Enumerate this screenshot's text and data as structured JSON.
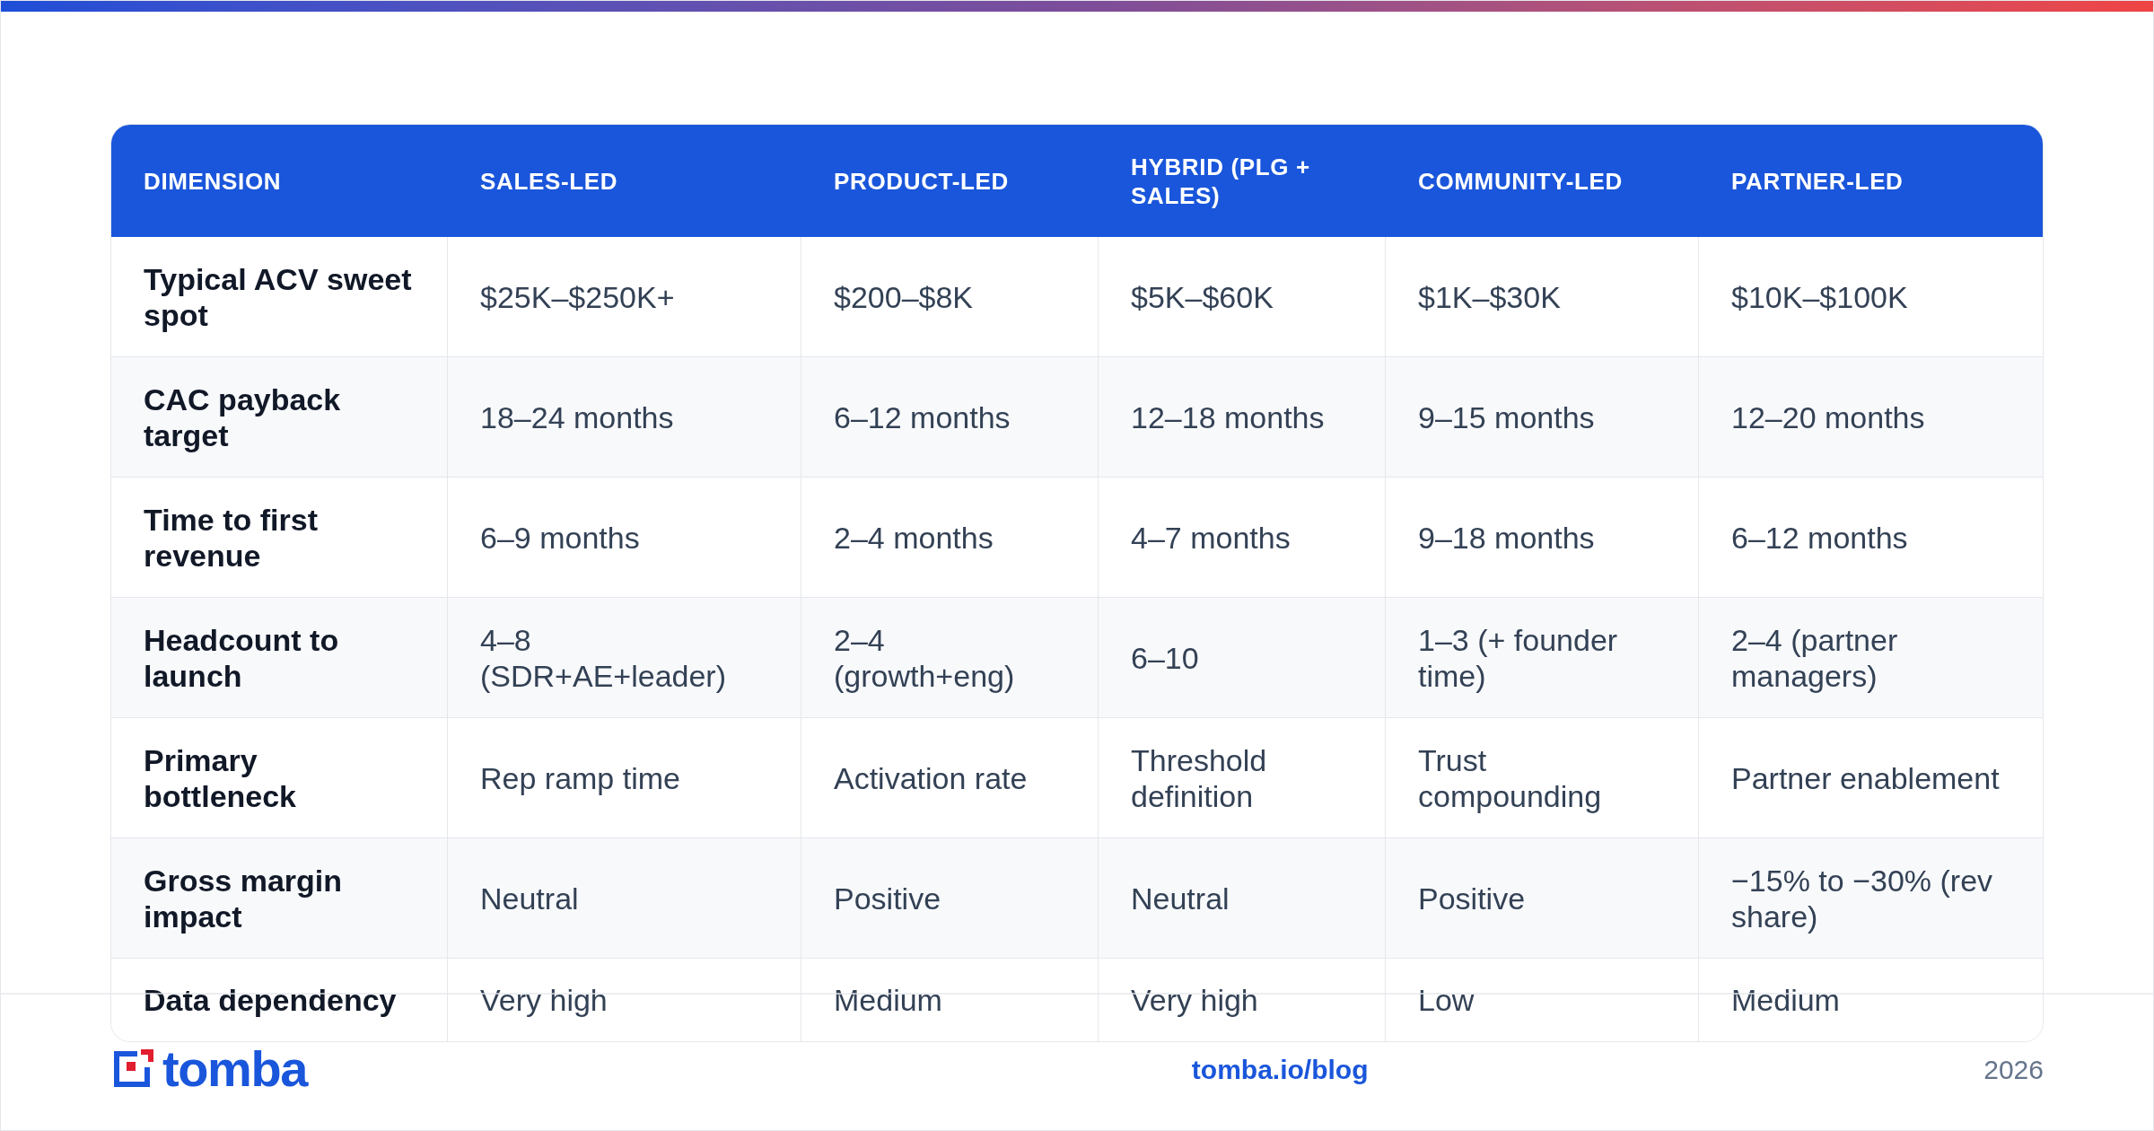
{
  "table": {
    "columns": [
      "DIMENSION",
      "SALES-LED",
      "PRODUCT-LED",
      "HYBRID (PLG + SALES)",
      "COMMUNITY-LED",
      "PARTNER-LED"
    ],
    "rows": [
      {
        "cells": [
          "Typical ACV sweet spot",
          "$25K–$250K+",
          "$200–$8K",
          "$5K–$60K",
          "$1K–$30K",
          "$10K–$100K"
        ]
      },
      {
        "cells": [
          "CAC payback target",
          "18–24 months",
          "6–12 months",
          "12–18 months",
          "9–15 months",
          "12–20 months"
        ]
      },
      {
        "cells": [
          "Time to first revenue",
          "6–9 months",
          "2–4 months",
          "4–7 months",
          "9–18 months",
          "6–12 months"
        ]
      },
      {
        "cells": [
          "Headcount to launch",
          "4–8 (SDR+AE+leader)",
          "2–4 (growth+eng)",
          "6–10",
          "1–3 (+ founder time)",
          "2–4 (partner managers)"
        ]
      },
      {
        "cells": [
          "Primary bottleneck",
          "Rep ramp time",
          "Activation rate",
          "Threshold definition",
          "Trust compounding",
          "Partner enablement"
        ]
      },
      {
        "cells": [
          "Gross margin impact",
          "Neutral",
          "Positive",
          "Neutral",
          "Positive",
          "−15% to −30% (rev share)"
        ]
      },
      {
        "cells": [
          "Data dependency",
          "Very high",
          "Medium",
          "Very high",
          "Low",
          "Medium"
        ]
      }
    ]
  },
  "footer": {
    "brand": "tomba",
    "link": "tomba.io/blog",
    "year": "2026"
  }
}
